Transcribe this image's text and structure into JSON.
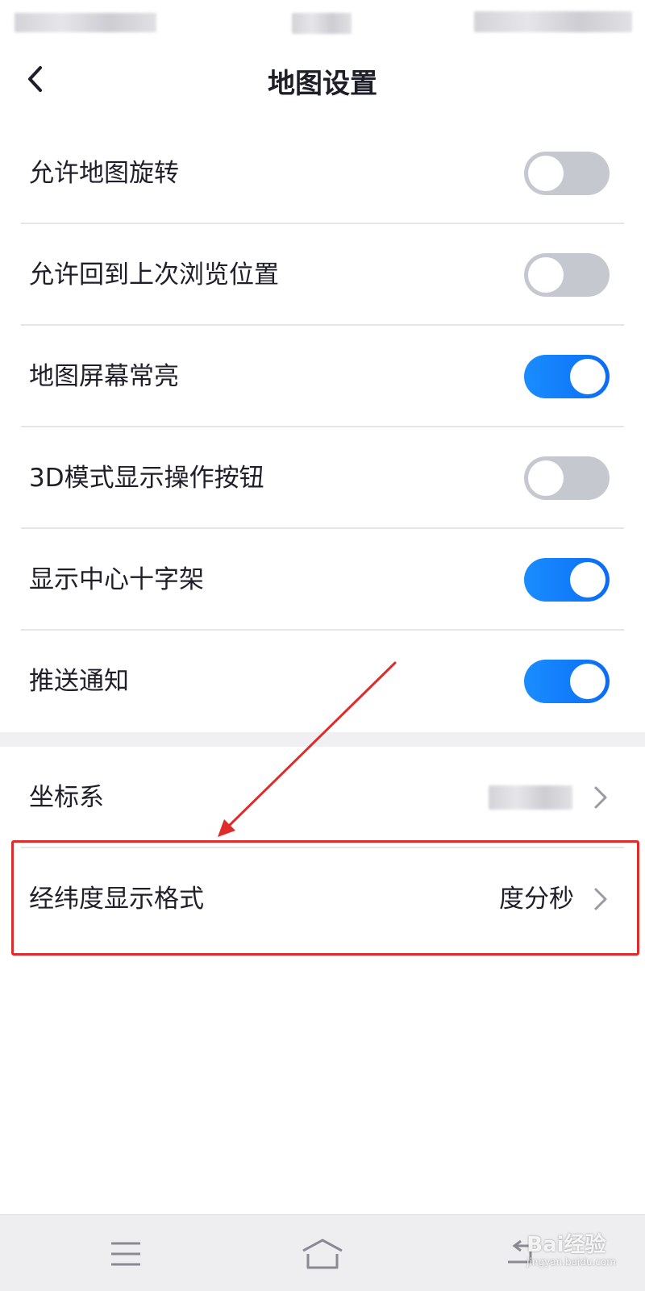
{
  "header": {
    "title": "地图设置",
    "back_icon": "chevron-left-icon"
  },
  "toggles": [
    {
      "label": "允许地图旋转",
      "state": "off"
    },
    {
      "label": "允许回到上次浏览位置",
      "state": "off"
    },
    {
      "label": "地图屏幕常亮",
      "state": "on"
    },
    {
      "label": "3D模式显示操作按钮",
      "state": "off"
    },
    {
      "label": "显示中心十字架",
      "state": "on"
    },
    {
      "label": "推送通知",
      "state": "on"
    }
  ],
  "nav_rows": [
    {
      "label": "坐标系",
      "value": ""
    },
    {
      "label": "经纬度显示格式",
      "value": "度分秒"
    }
  ],
  "colors": {
    "toggle_on": "#0a6cf5",
    "toggle_off": "#c5c8cf",
    "annotation": "#e02b2b"
  },
  "bottom_bar": {
    "icons": [
      "menu-icon",
      "home-icon",
      "back-icon"
    ]
  },
  "watermark": {
    "text": "Bai经验",
    "sub": "jingyan.baidu.com"
  }
}
